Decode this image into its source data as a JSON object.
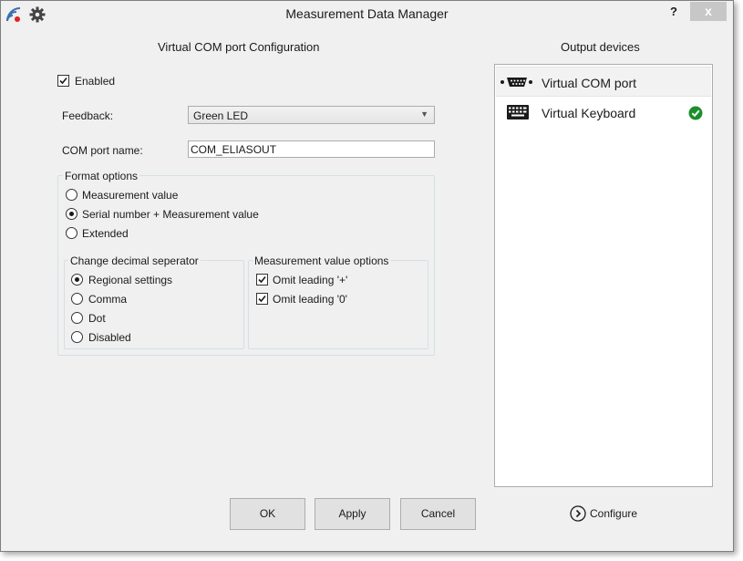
{
  "window": {
    "title": "Measurement Data Manager",
    "help": "?",
    "close": "x"
  },
  "config": {
    "section_title": "Virtual COM port Configuration",
    "enabled_label": "Enabled",
    "enabled": true,
    "feedback_label": "Feedback:",
    "feedback_value": "Green LED",
    "com_name_label": "COM port name:",
    "com_name_value": "COM_ELIASOUT"
  },
  "format": {
    "group_title": "Format options",
    "options": [
      "Measurement value",
      "Serial number + Measurement value",
      "Extended"
    ],
    "selected": 1
  },
  "decimal": {
    "group_title": "Change decimal seperator",
    "options": [
      "Regional settings",
      "Comma",
      "Dot",
      "Disabled"
    ],
    "selected": 0
  },
  "mvopts": {
    "group_title": "Measurement value options",
    "options": [
      "Omit leading '+'",
      "Omit leading '0'"
    ],
    "checked": [
      true,
      true
    ]
  },
  "output": {
    "section_title": "Output devices",
    "devices": [
      {
        "name": "Virtual COM port",
        "icon": "serial-port-icon",
        "active": false
      },
      {
        "name": "Virtual Keyboard",
        "icon": "keyboard-icon",
        "active": true
      }
    ],
    "configure_label": "Configure"
  },
  "buttons": {
    "ok": "OK",
    "apply": "Apply",
    "cancel": "Cancel"
  },
  "colors": {
    "accent_green": "#1a8f2a",
    "close_bg": "#c7c7c7"
  }
}
